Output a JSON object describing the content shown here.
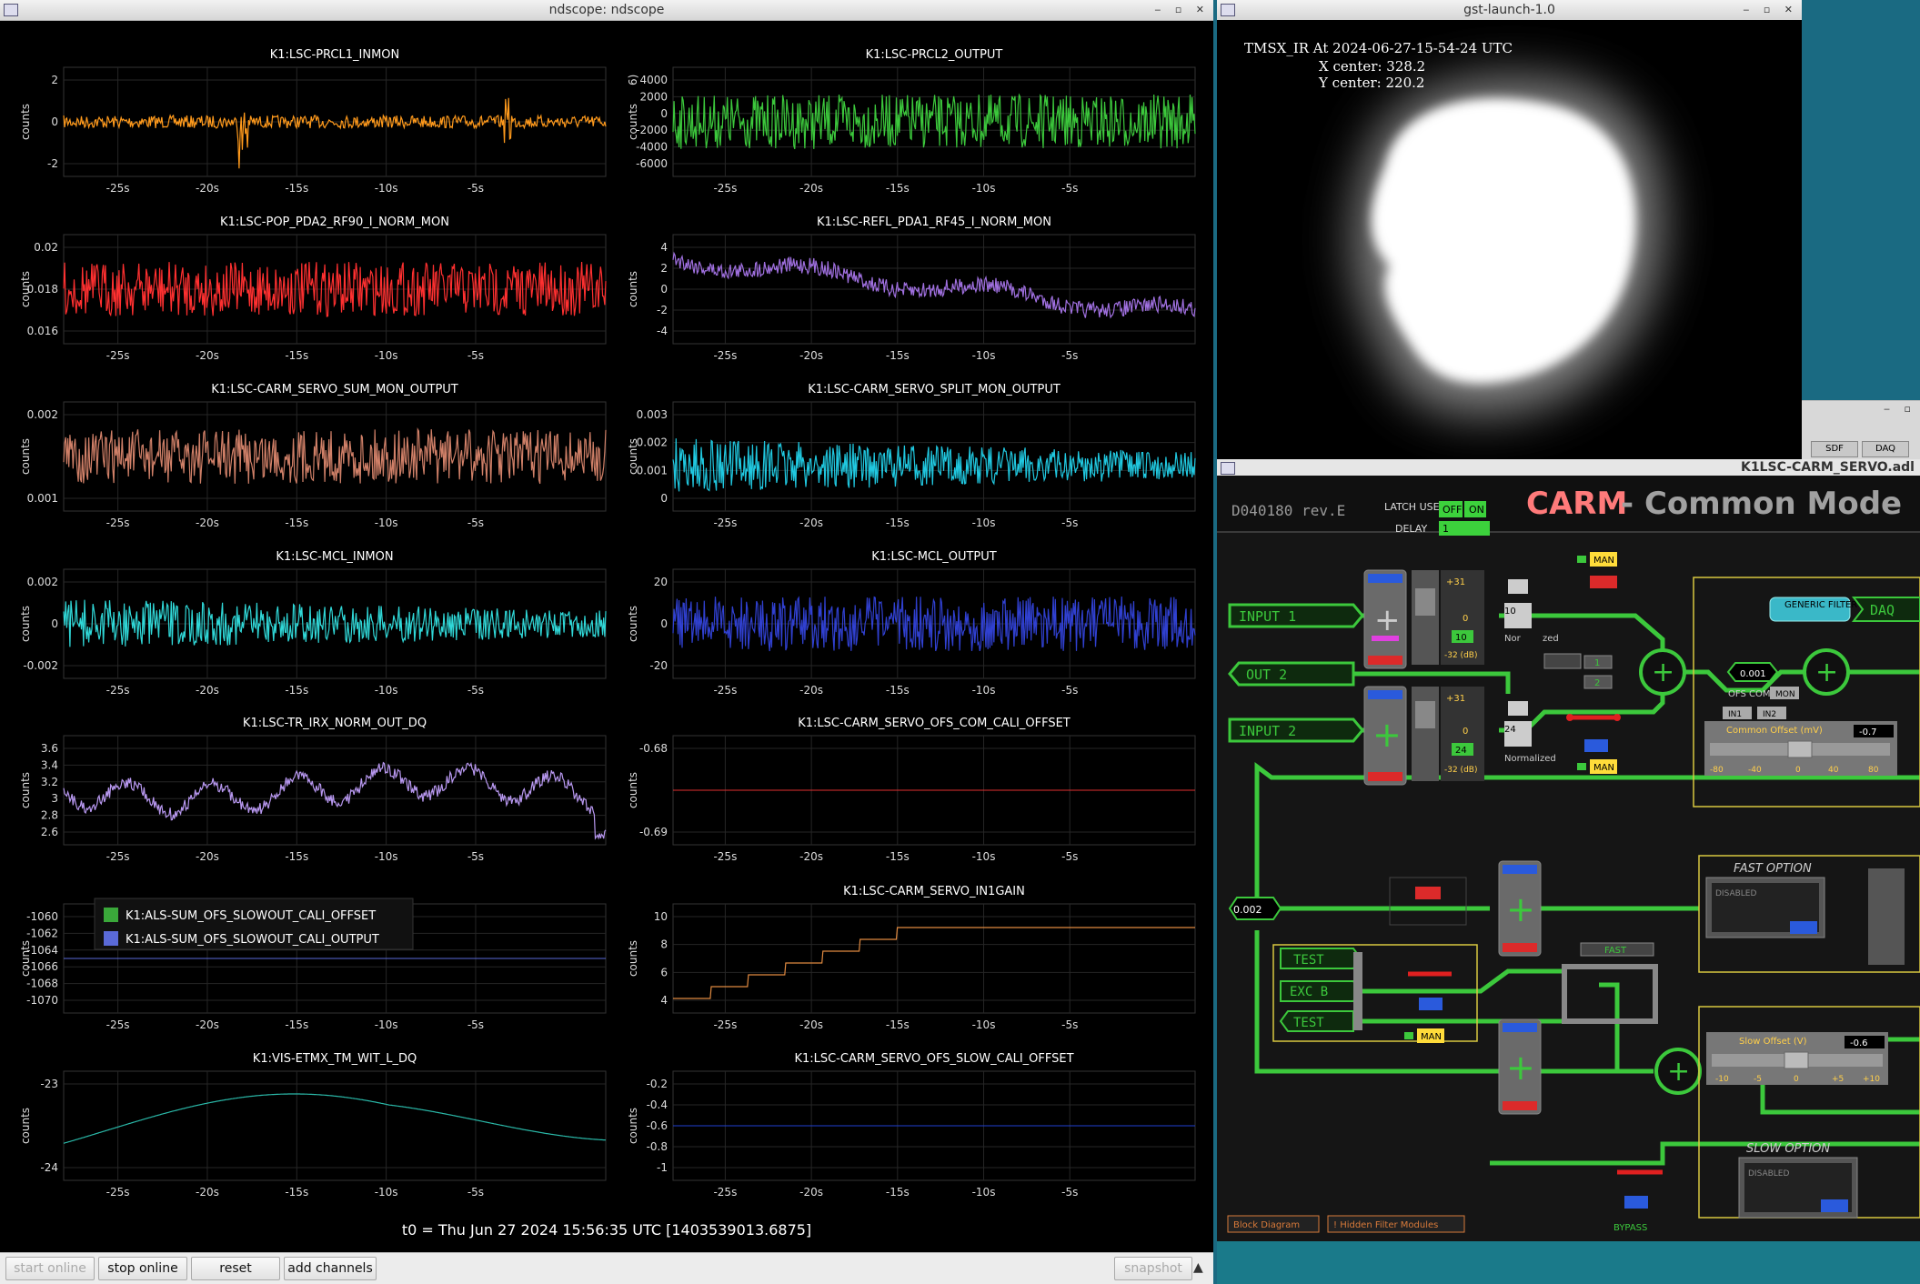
{
  "ndscope": {
    "window_title": "ndscope: ndscope",
    "t0_text": "t0 = Thu Jun 27 2024 15:56:35 UTC [1403539013.6875]",
    "y_axis_label": "counts",
    "buttons": {
      "start_online": "start online",
      "stop_online": "stop online",
      "reset": "reset",
      "add_channels": "add channels",
      "snapshot": "snapshot"
    },
    "plots": [
      {
        "title": "K1:LSC-PRCL1_INMON",
        "color": "#ff9a1c",
        "yticks": [
          "2",
          "0",
          "-2"
        ],
        "xticks": [
          "-25s",
          "-20s",
          "-15s",
          "-10s",
          "-5s"
        ]
      },
      {
        "title": "K1:LSC-PRCL2_OUTPUT",
        "color": "#3cc83c",
        "yticks": [
          "4000",
          "2000",
          "0",
          "-2000",
          "-4000",
          "-6000"
        ],
        "xticks": [
          "-25s",
          "-20s",
          "-15s",
          "-10s",
          "-5s"
        ],
        "extra": "6)"
      },
      {
        "title": "K1:LSC-POP_PDA2_RF90_I_NORM_MON",
        "color": "#ff3030",
        "yticks": [
          "0.02",
          "0.018",
          "0.016"
        ],
        "xticks": [
          "-25s",
          "-20s",
          "-15s",
          "-10s",
          "-5s"
        ]
      },
      {
        "title": "K1:LSC-REFL_PDA1_RF45_I_NORM_MON",
        "color": "#a070e0",
        "yticks": [
          "4",
          "2",
          "0",
          "-2",
          "-4"
        ],
        "xticks": [
          "-25s",
          "-20s",
          "-15s",
          "-10s",
          "-5s"
        ]
      },
      {
        "title": "K1:LSC-CARM_SERVO_SUM_MON_OUTPUT",
        "color": "#d08068",
        "yticks": [
          "0.002",
          "0.001"
        ],
        "xticks": [
          "-25s",
          "-20s",
          "-15s",
          "-10s",
          "-5s"
        ]
      },
      {
        "title": "K1:LSC-CARM_SERVO_SPLIT_MON_OUTPUT",
        "color": "#20c8e0",
        "yticks": [
          "0.003",
          "0.002",
          "0.001",
          "0"
        ],
        "xticks": [
          "-25s",
          "-20s",
          "-15s",
          "-10s",
          "-5s"
        ]
      },
      {
        "title": "K1:LSC-MCL_INMON",
        "color": "#30d8d8",
        "yticks": [
          "0.002",
          "0",
          "-0.002"
        ],
        "xticks": [
          "-25s",
          "-20s",
          "-15s",
          "-10s",
          "-5s"
        ]
      },
      {
        "title": "K1:LSC-MCL_OUTPUT",
        "color": "#3040d0",
        "yticks": [
          "20",
          "0",
          "-20"
        ],
        "xticks": [
          "-25s",
          "-20s",
          "-15s",
          "-10s",
          "-5s"
        ]
      },
      {
        "title": "K1:LSC-TR_IRX_NORM_OUT_DQ",
        "color": "#b898f0",
        "yticks": [
          "3.6",
          "3.4",
          "3.2",
          "3",
          "2.8",
          "2.6"
        ],
        "xticks": [
          "-25s",
          "-20s",
          "-15s",
          "-10s",
          "-5s"
        ]
      },
      {
        "title": "K1:LSC-CARM_SERVO_OFS_COM_CALI_OFFSET",
        "color": "#e03030",
        "yticks": [
          "-0.68",
          "-0.69"
        ],
        "xticks": [
          "-25s",
          "-20s",
          "-15s",
          "-10s",
          "-5s"
        ]
      },
      {
        "title": "",
        "color": "#5a6ad8",
        "yticks": [
          "-1060",
          "-1062",
          "-1064",
          "-1066",
          "-1068",
          "-1070"
        ],
        "xticks": [
          "-25s",
          "-20s",
          "-15s",
          "-10s",
          "-5s"
        ],
        "legend": [
          {
            "label": "K1:ALS-SUM_OFS_SLOWOUT_CALI_OFFSET",
            "color": "#3aa83a"
          },
          {
            "label": "K1:ALS-SUM_OFS_SLOWOUT_CALI_OUTPUT",
            "color": "#5a6ad8"
          }
        ]
      },
      {
        "title": "K1:LSC-CARM_SERVO_IN1GAIN",
        "color": "#e08a40",
        "yticks": [
          "10",
          "8",
          "6",
          "4"
        ],
        "xticks": [
          "-25s",
          "-20s",
          "-15s",
          "-10s",
          "-5s"
        ]
      },
      {
        "title": "K1:VIS-ETMX_TM_WIT_L_DQ",
        "color": "#2ab8a8",
        "yticks": [
          "-23",
          "-24"
        ],
        "xticks": [
          "-25s",
          "-20s",
          "-15s",
          "-10s",
          "-5s"
        ]
      },
      {
        "title": "K1:LSC-CARM_SERVO_OFS_SLOW_CALI_OFFSET",
        "color": "#2040d0",
        "yticks": [
          "-0.2",
          "-0.4",
          "-0.6",
          "-0.8",
          "-1"
        ],
        "xticks": [
          "-25s",
          "-20s",
          "-15s",
          "-10s",
          "-5s"
        ]
      }
    ]
  },
  "gst": {
    "window_title": "gst-launch-1.0",
    "line1": "TMSX_IR At 2024-06-27-15-54-24 UTC",
    "line2": "X center: 328.2",
    "line3": "Y center: 220.2"
  },
  "carm": {
    "window_title": "K1LSC-CARM_SERVO.adl",
    "doc_id": "D040180 rev.E",
    "title_main": "CARM",
    "title_rest": "- Common Mode",
    "latch_use": "LATCH USE",
    "off": "OFF",
    "on": "ON",
    "delay": "DELAY",
    "delay_val": "1",
    "input1": "INPUT 1",
    "out2": "OUT 2",
    "input2": "INPUT 2",
    "generic_filter": "GENERIC FILTER",
    "daq": "DAQ",
    "man": "MAN",
    "val_0001": "0.001",
    "val_0002": "0.002",
    "ofs_comp": "OFS COMP",
    "mon": "MON",
    "in1": "IN1",
    "in2": "IN2",
    "common_offset": "Common Offset (mV)",
    "common_offset_val": "-0.7",
    "common_ticks": [
      "-80",
      "-40",
      "0",
      "40",
      "80"
    ],
    "gain_plus31": "+31",
    "gain_zero": "0",
    "gain_minus32": "-32 (dB)",
    "g1_val": "10",
    "g2_val": "24",
    "normalized": "Normalized",
    "nor": "Nor",
    "zed": "zed",
    "btn1": "1",
    "btn2": "2",
    "fast_option": "FAST OPTION",
    "disabled": "DISABLED",
    "fast": "FAST",
    "test": "TEST",
    "exc_b": "EXC B",
    "slow_offset": "Slow Offset (V)",
    "slow_offset_val": "-0.6",
    "slow_ticks": [
      "-10",
      "-5",
      "0",
      "+5",
      "+10"
    ],
    "slow_option": "SLOW OPTION",
    "bypass": "BYPASS",
    "block_diagram": "Block Diagram",
    "hidden_filter": "! Hidden Filter Modules",
    "small_win_btns": [
      "SDF",
      "DAQ"
    ]
  }
}
